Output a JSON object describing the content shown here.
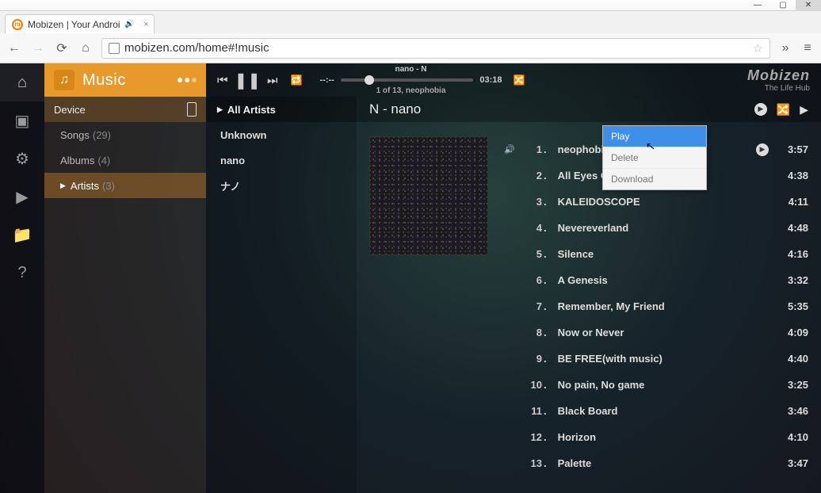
{
  "browser": {
    "tab_title": "Mobizen | Your Androi",
    "url": "mobizen.com/home#!music"
  },
  "brand": {
    "section": "Music",
    "logo_line1": "Mobizen",
    "logo_line2": "The Life Hub"
  },
  "player": {
    "now_playing_title": "nano - N",
    "elapsed": "--:--",
    "total": "03:18",
    "position_info": "1 of 13, neophobia"
  },
  "rail": [
    {
      "id": "home",
      "glyph": "⌂"
    },
    {
      "id": "gallery",
      "glyph": "▣"
    },
    {
      "id": "settings",
      "glyph": "⚙"
    },
    {
      "id": "play",
      "glyph": "▶"
    },
    {
      "id": "files",
      "glyph": "📁"
    },
    {
      "id": "help",
      "glyph": "?"
    }
  ],
  "library": {
    "header": "Device",
    "items": [
      {
        "label": "Songs",
        "count": "(29)",
        "selected": false
      },
      {
        "label": "Albums",
        "count": "(4)",
        "selected": false
      },
      {
        "label": "Artists",
        "count": "(3)",
        "selected": true
      }
    ]
  },
  "artists": {
    "header": "All Artists",
    "items": [
      "Unknown",
      "nano",
      "ナノ"
    ]
  },
  "content": {
    "title": "N - nano"
  },
  "tracks": [
    {
      "n": 1,
      "name": "neophobia",
      "dur": "3:57",
      "playing": true
    },
    {
      "n": 2,
      "name": "All Eyes On Me",
      "dur": "4:38"
    },
    {
      "n": 3,
      "name": "KALEIDOSCOPE",
      "dur": "4:11"
    },
    {
      "n": 4,
      "name": "Nevereverland",
      "dur": "4:48"
    },
    {
      "n": 5,
      "name": "Silence",
      "dur": "4:16"
    },
    {
      "n": 6,
      "name": "A Genesis",
      "dur": "3:32"
    },
    {
      "n": 7,
      "name": "Remember, My Friend",
      "dur": "5:35"
    },
    {
      "n": 8,
      "name": "Now or Never",
      "dur": "4:09"
    },
    {
      "n": 9,
      "name": "BE FREE(with music)",
      "dur": "4:40"
    },
    {
      "n": 10,
      "name": "No pain, No game",
      "dur": "3:25"
    },
    {
      "n": 11,
      "name": "Black Board",
      "dur": "3:46"
    },
    {
      "n": 12,
      "name": "Horizon",
      "dur": "4:10"
    },
    {
      "n": 13,
      "name": "Palette",
      "dur": "3:47"
    }
  ],
  "context_menu": {
    "items": [
      {
        "label": "Play",
        "hover": true
      },
      {
        "label": "Delete"
      },
      {
        "label": "Download"
      }
    ]
  }
}
